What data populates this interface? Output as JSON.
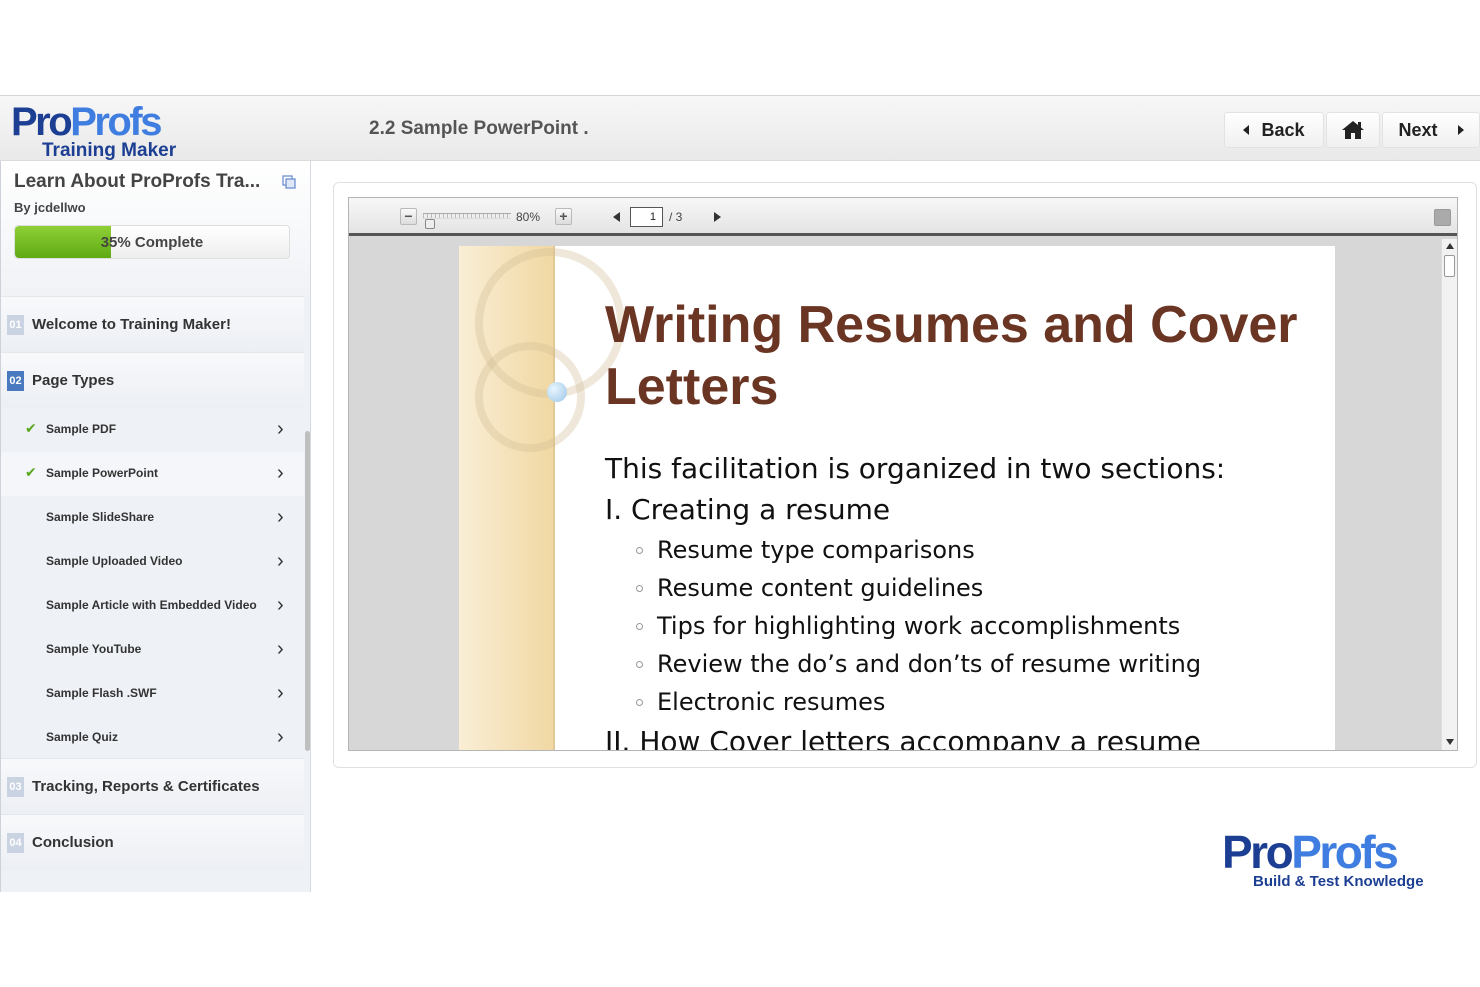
{
  "brand": {
    "logo_part1": "Pro",
    "logo_part2": "Profs",
    "logo_subtitle": "Training Maker",
    "footer_logo_part1": "Pro",
    "footer_logo_part2": "Profs",
    "footer_tagline": "Build & Test Knowledge",
    "colors": {
      "dark_blue": "#1d3f93",
      "light_blue": "#3f7ee0",
      "progress_green": "#6cb91b",
      "slide_title": "#6b3523"
    }
  },
  "header": {
    "page_heading": "2.2 Sample PowerPoint .",
    "back_label": "Back",
    "next_label": "Next",
    "home_icon": "home-icon"
  },
  "sidebar": {
    "course_title": "Learn About ProProfs Tra...",
    "author": "By jcdellwo",
    "progress_percent": 35,
    "progress_text": "35% Complete",
    "chapters": [
      {
        "num": "01",
        "title": "Welcome to Training Maker!"
      },
      {
        "num": "02",
        "title": "Page Types"
      },
      {
        "num": "03",
        "title": "Tracking, Reports & Certificates"
      },
      {
        "num": "04",
        "title": "Conclusion"
      }
    ],
    "page_types": [
      {
        "label": "Sample PDF",
        "completed": true
      },
      {
        "label": "Sample PowerPoint",
        "completed": true
      },
      {
        "label": "Sample SlideShare",
        "completed": false
      },
      {
        "label": "Sample Uploaded Video",
        "completed": false
      },
      {
        "label": "Sample Article with Embedded Video",
        "completed": false
      },
      {
        "label": "Sample YouTube",
        "completed": false
      },
      {
        "label": "Sample Flash .SWF",
        "completed": false
      },
      {
        "label": "Sample Quiz",
        "completed": false
      }
    ]
  },
  "viewer": {
    "zoom": "80%",
    "current_page": "1",
    "total_pages": "/ 3",
    "zoom_out_symbol": "−",
    "zoom_in_symbol": "+"
  },
  "slide": {
    "title": "Writing Resumes and Cover Letters",
    "intro": "This facilitation is organized in two sections:",
    "section1": "I. Creating a resume",
    "bullets": [
      "Resume type comparisons",
      "Resume content guidelines",
      "Tips for highlighting work accomplishments",
      "Review the do’s and don’ts of resume writing",
      "Electronic resumes"
    ],
    "section2": "II. How Cover letters accompany a resume"
  }
}
